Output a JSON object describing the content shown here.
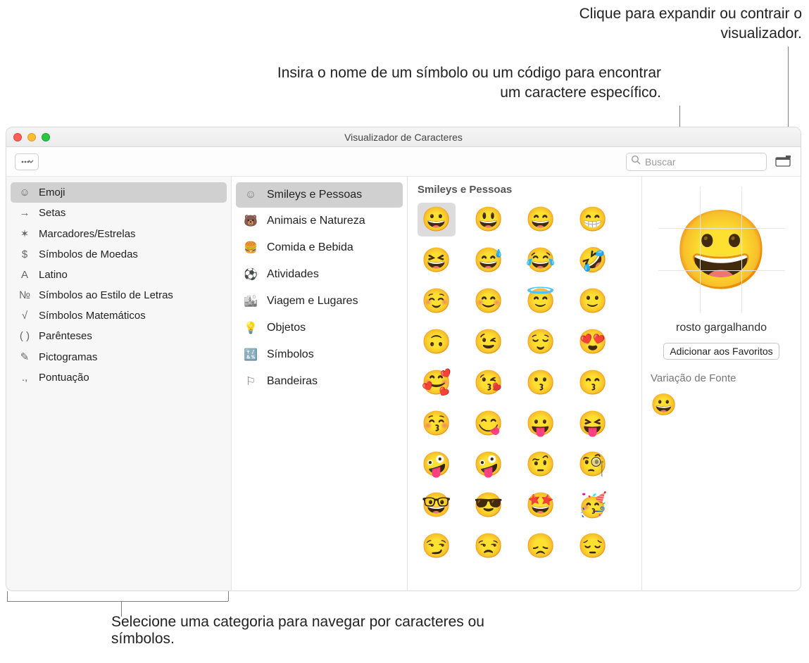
{
  "callouts": {
    "expand": "Clique para expandir ou contrair o visualizador.",
    "search": "Insira o nome de um símbolo ou um código para encontrar um caractere específico.",
    "category": "Selecione uma categoria para navegar por caracteres ou símbolos."
  },
  "window": {
    "title": "Visualizador de Caracteres"
  },
  "toolbar": {
    "search_placeholder": "Buscar"
  },
  "sidebar": {
    "items": [
      {
        "icon": "☺",
        "label": "Emoji",
        "selected": true
      },
      {
        "icon": "→",
        "label": "Setas"
      },
      {
        "icon": "✶",
        "label": "Marcadores/Estrelas"
      },
      {
        "icon": "$",
        "label": "Símbolos de Moedas"
      },
      {
        "icon": "A",
        "label": "Latino"
      },
      {
        "icon": "№",
        "label": "Símbolos ao Estilo de Letras"
      },
      {
        "icon": "√",
        "label": "Símbolos Matemáticos"
      },
      {
        "icon": "( )",
        "label": "Parênteses"
      },
      {
        "icon": "✎",
        "label": "Pictogramas"
      },
      {
        "icon": ".,",
        "label": "Pontuação"
      }
    ]
  },
  "subcategories": {
    "items": [
      {
        "icon": "☺",
        "label": "Smileys e Pessoas",
        "selected": true
      },
      {
        "icon": "🐻",
        "label": "Animais e Natureza"
      },
      {
        "icon": "🍔",
        "label": "Comida e Bebida"
      },
      {
        "icon": "⚽",
        "label": "Atividades"
      },
      {
        "icon": "🏙",
        "label": "Viagem e Lugares"
      },
      {
        "icon": "💡",
        "label": "Objetos"
      },
      {
        "icon": "🔣",
        "label": "Símbolos"
      },
      {
        "icon": "⚐",
        "label": "Bandeiras"
      }
    ]
  },
  "grid": {
    "title": "Smileys e Pessoas",
    "emojis": [
      "😀",
      "😃",
      "😄",
      "😁",
      "😆",
      "😅",
      "😂",
      "🤣",
      "☺️",
      "😊",
      "😇",
      "🙂",
      "🙃",
      "😉",
      "😌",
      "😍",
      "🥰",
      "😘",
      "😗",
      "😙",
      "😚",
      "😋",
      "😛",
      "😝",
      "🤪",
      "🤪",
      "🤨",
      "🧐",
      "🤓",
      "😎",
      "🤩",
      "🥳",
      "😏",
      "😒",
      "😞",
      "😔"
    ],
    "selected_index": 0
  },
  "detail": {
    "preview": "😀",
    "name": "rosto gargalhando",
    "favorite_button": "Adicionar aos Favoritos",
    "variation_title": "Variação de Fonte",
    "variation": "😀"
  }
}
